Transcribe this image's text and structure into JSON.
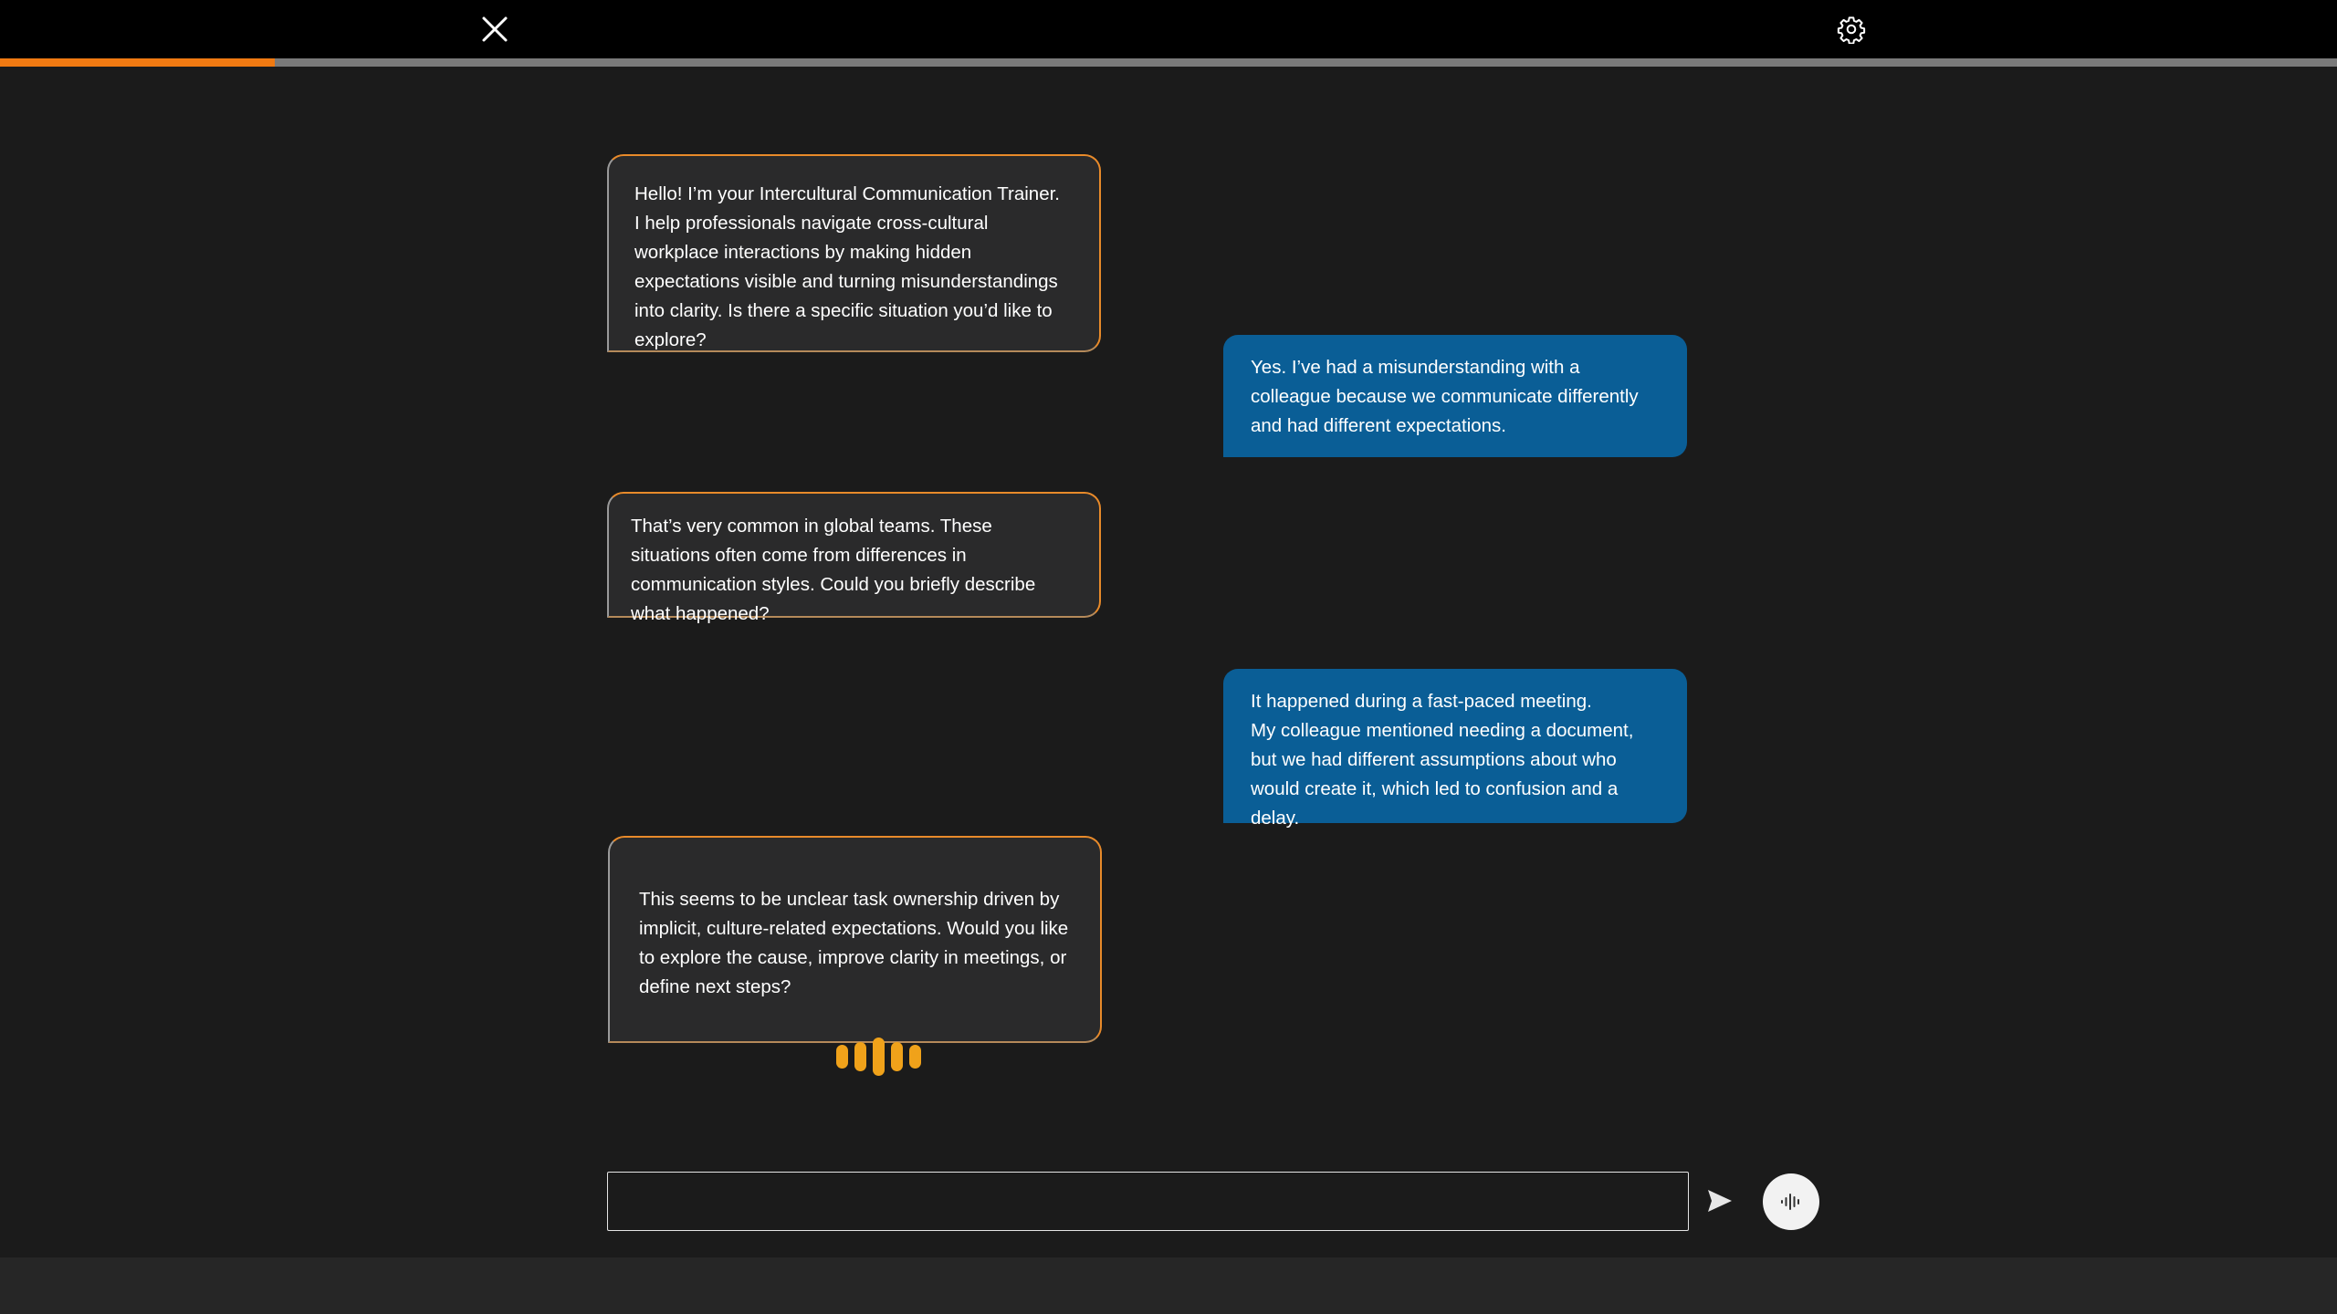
{
  "header": {
    "close_icon": "close-icon",
    "settings_icon": "gear-icon",
    "progress_fraction": 0.1175,
    "progress_color": "#f07a12",
    "track_color": "#7a7a7a"
  },
  "messages": [
    {
      "role": "assistant",
      "text": "Hello! I’m your Intercultural Communication Trainer.\nI help professionals navigate cross-cultural workplace interactions by making hidden expectations visible and turning misunderstandings into clarity. Is there a specific situation you’d like to explore?"
    },
    {
      "role": "user",
      "text": "Yes. I’ve had a misunderstanding with a colleague because we communicate differently and had different expectations."
    },
    {
      "role": "assistant",
      "text": "That’s very common in global teams. These situations often come from differences in communication styles. Could you briefly describe what happened?"
    },
    {
      "role": "user",
      "text": "It happened during a fast-paced meeting.\nMy colleague mentioned needing a document, but we had different assumptions about who would create it, which led to confusion and a delay."
    },
    {
      "role": "assistant",
      "text": "This seems to be unclear task ownership driven by implicit, culture-related expectations. Would you like to explore the cause, improve clarity in meetings, or define next steps?",
      "speaking_indicator": "audio-wave-icon"
    }
  ],
  "composer": {
    "value": "",
    "placeholder": "",
    "send_icon": "send-icon",
    "voice_icon": "voice-waveform-icon"
  },
  "colors": {
    "assistant_border": "#e88a2a",
    "user_bubble": "#0a5e96",
    "speaking_indicator": "#f0a21a"
  }
}
